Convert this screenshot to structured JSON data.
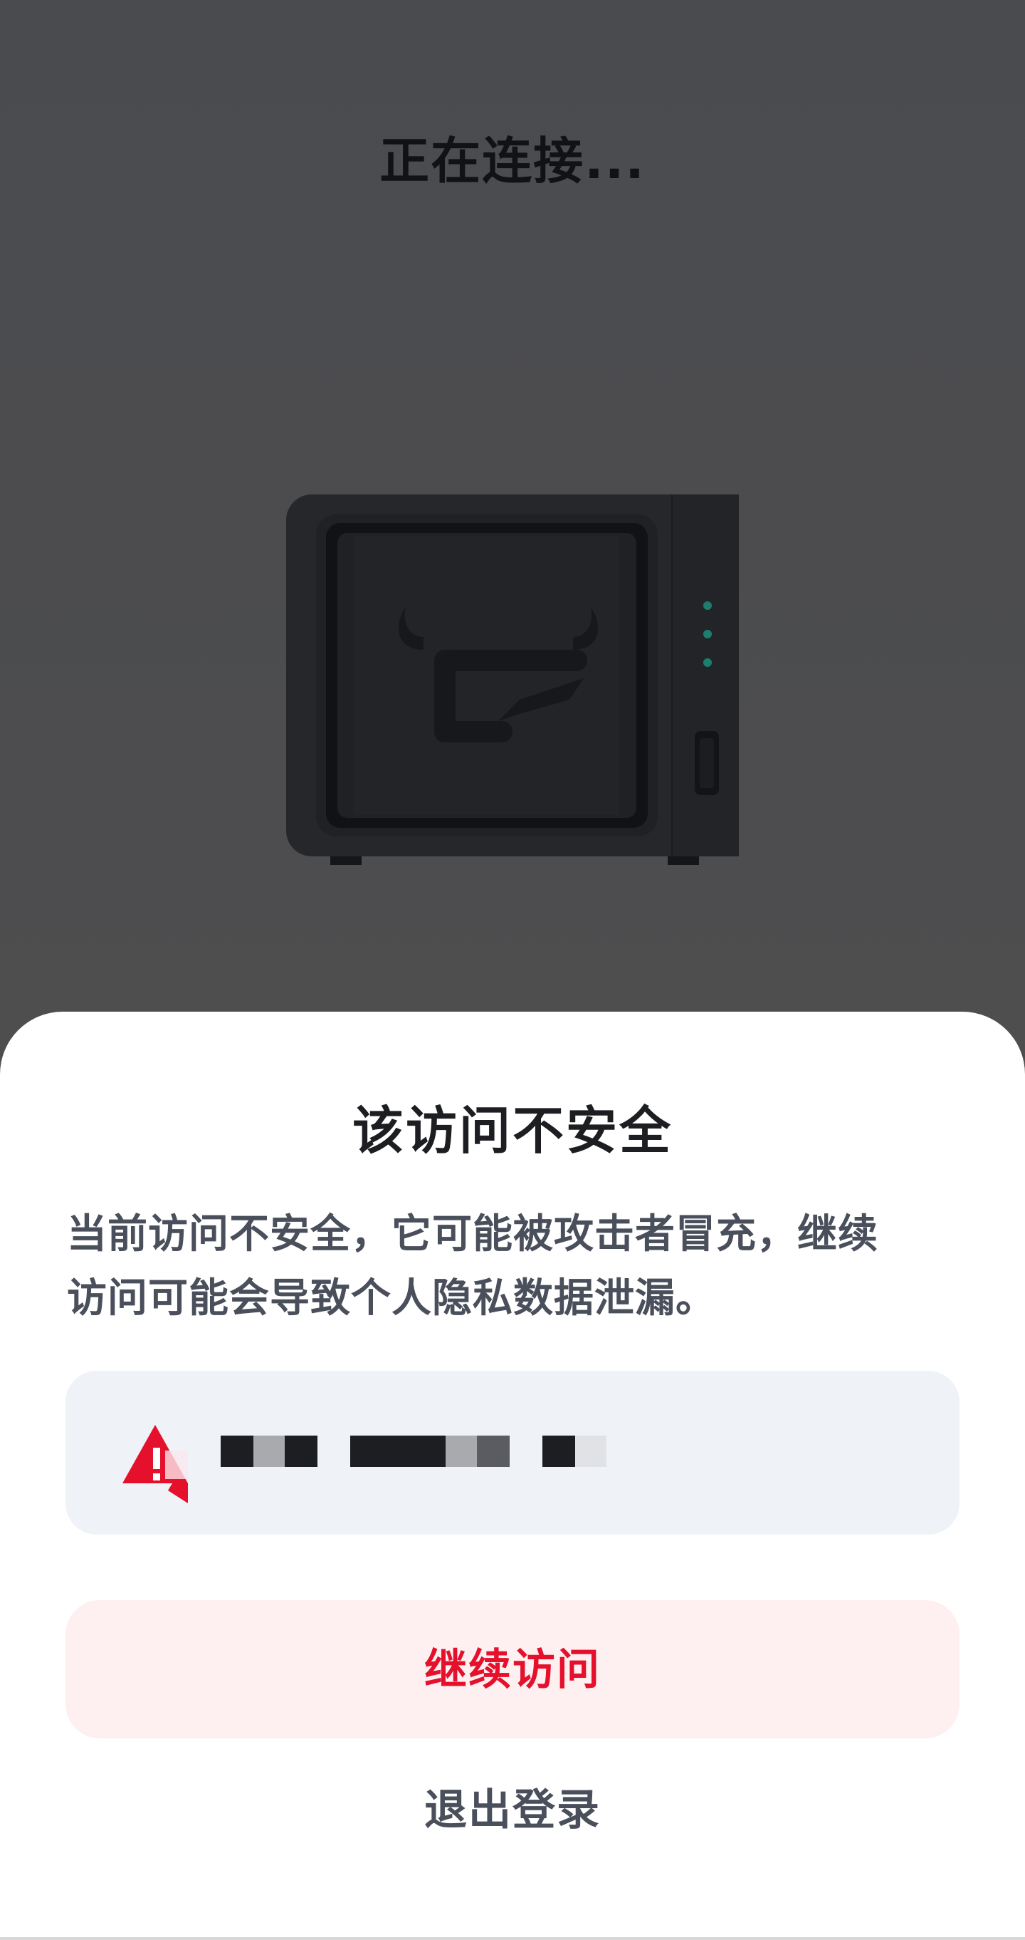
{
  "background_screen": {
    "title": "正在连接..."
  },
  "dialog": {
    "title": "该访问不安全",
    "message_line1": "当前访问不安全，它可能被攻击者冒充，继续",
    "message_line2": "访问可能会导致个人隐私数据泄漏。",
    "host_value_obscured": true,
    "continue_label": "继续访问",
    "logout_label": "退出登录"
  },
  "icons": {
    "device": "nas-device-icon",
    "warning": "warning-triangle-icon"
  },
  "colors": {
    "accent": "#e5102b",
    "accent_bg": "#fef0f0",
    "host_bg": "#eff2f7",
    "overlay": "#4d4d4f",
    "text_primary": "#1d1e22",
    "text_secondary": "#4a4f5c"
  }
}
